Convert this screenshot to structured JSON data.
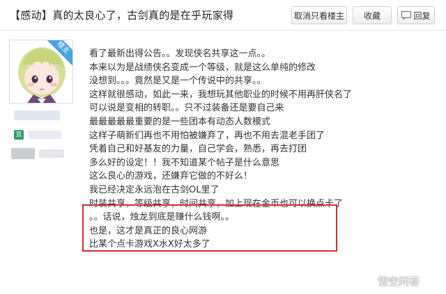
{
  "post": {
    "title": "【感动】真的太良心了，古剑真的是在乎玩家得"
  },
  "toolbar": {
    "only_author_label": "取消只看楼主",
    "favorite_label": "收藏",
    "reply_label": "回复"
  },
  "author": {
    "badge": "楼主",
    "level_glyph": "亘"
  },
  "content": {
    "lines": [
      "看了最新出得公告。。发现侠名共享这一点。。",
      "本来以为是战绩侠名变成一个等级，就是这么单纯的修改",
      "没想到。。。竟然是又是一个传说中的共享。。",
      "这样就很感动，如此一来，我想玩其他职业的时候不用再肝侠名了",
      "可以说是变相的转职。。只不过装备还是要自己来",
      "最最最最最重要的是一些团本有动态人数模式",
      "这样子萌新们再也不用怕被嫌弃了，再也不用去混老手团了",
      "凭着自己和好基友的力量，自己学会，熟悉，再去打团",
      "多么好的设定！！我不知道某个帖子是什么意思",
      "这么良心的游戏，还嫌弃它做的不好么！",
      "我已经决定永远泡在古剑OL里了",
      "时装共享，等级共享，时间共享，加上现在金币也可以换点卡了",
      "。。话说，烛龙到底是赚什么钱啊。。",
      "也是，这才是真正的良心网游",
      "比某个点卡游戏X水X好太多了"
    ]
  },
  "watermark": {
    "text": "悟空问答"
  },
  "colors": {
    "highlight_border": "#c9302c",
    "badge_bg": "#4aa3e0"
  }
}
